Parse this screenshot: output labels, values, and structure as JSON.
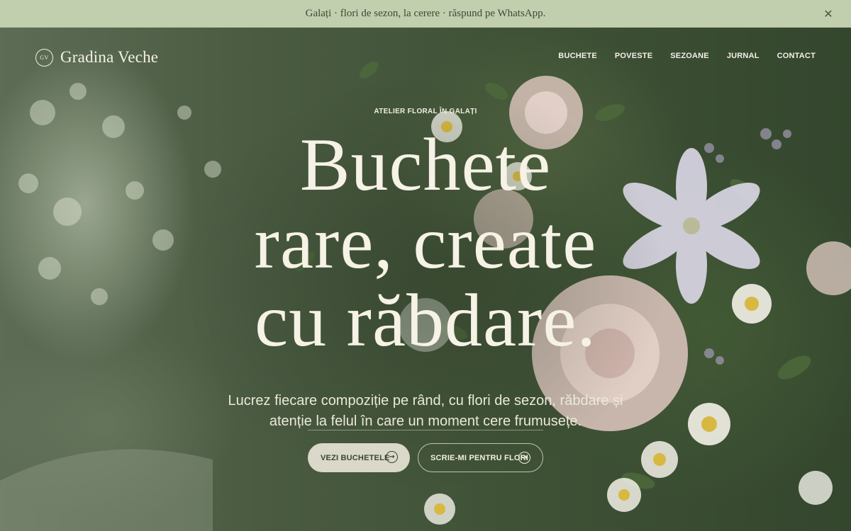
{
  "announcement": {
    "text": "Galați · flori de sezon, la cerere · răspund pe WhatsApp.",
    "close_icon": "✕"
  },
  "brand": {
    "monogram": "GV",
    "name": "Gradina Veche"
  },
  "nav": {
    "items": [
      "BUCHETE",
      "POVESTE",
      "SEZOANE",
      "JURNAL",
      "CONTACT"
    ]
  },
  "hero": {
    "eyebrow": "ATELIER FLORAL ÎN GALAȚI",
    "headline_lines": [
      "Buchete",
      "rare, create",
      "cu răbdare."
    ],
    "lede": "Lucrez fiecare compoziție pe rând, cu flori de sezon, răbdare și atenție la felul în care un moment cere frumusețe.",
    "primary_cta": "VEZI BUCHETELE",
    "secondary_cta": "SCRIE-MI PENTRU FLORI",
    "cta_icon": "arrow-right-circle-icon"
  },
  "colors": {
    "announcement_bg": "#c1cfae",
    "hero_overlay": "#3f5236",
    "text_light": "#f6f2e6",
    "primary_button_bg": "#d9d8c9"
  }
}
